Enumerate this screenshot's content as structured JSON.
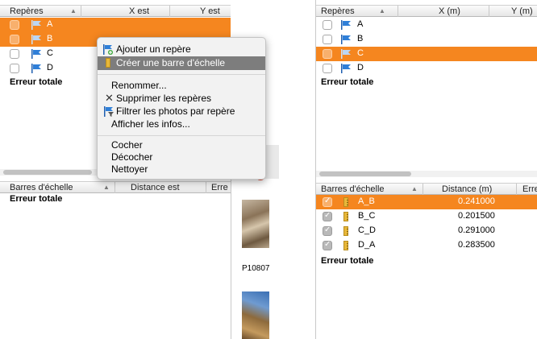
{
  "left_panel": {
    "markers_header": {
      "name": "Repères",
      "x": "X est",
      "y": "Y est"
    },
    "markers": [
      {
        "label": "A",
        "selected": true,
        "checked": false
      },
      {
        "label": "B",
        "selected": true,
        "checked": false
      },
      {
        "label": "C",
        "selected": false,
        "checked": false
      },
      {
        "label": "D",
        "selected": false,
        "checked": false
      }
    ],
    "total_error": "Erreur totale",
    "scalebars_header": {
      "name": "Barres d'échelle",
      "distance": "Distance est",
      "error": "Erre"
    },
    "scalebars_total_error": "Erreur totale"
  },
  "context_menu": {
    "items": [
      {
        "label": "Ajouter un repère",
        "icon": "flag-add-icon"
      },
      {
        "label": "Créer une barre d'échelle",
        "icon": "ruler-icon",
        "highlighted": true
      },
      {
        "label": "Renommer..."
      },
      {
        "label": "Supprimer les repères",
        "icon": "x-icon"
      },
      {
        "label": "Filtrer les photos par repère",
        "icon": "filter-flag-icon"
      },
      {
        "label": "Afficher les infos..."
      },
      {
        "label": "Cocher"
      },
      {
        "label": "Décocher"
      },
      {
        "label": "Nettoyer"
      }
    ]
  },
  "photo_panel": {
    "thumb_label": "P10807"
  },
  "right_panel": {
    "markers_header": {
      "name": "Repères",
      "x": "X (m)",
      "y": "Y (m)"
    },
    "markers": [
      {
        "label": "A",
        "selected": false
      },
      {
        "label": "B",
        "selected": false
      },
      {
        "label": "C",
        "selected": true
      },
      {
        "label": "D",
        "selected": false
      }
    ],
    "total_error": "Erreur totale",
    "scalebars_header": {
      "name": "Barres d'échelle",
      "distance": "Distance (m)",
      "error": "Erre"
    },
    "scalebars": [
      {
        "label": "A_B",
        "distance": "0.241000",
        "selected": true
      },
      {
        "label": "B_C",
        "distance": "0.201500",
        "selected": false
      },
      {
        "label": "C_D",
        "distance": "0.291000",
        "selected": false
      },
      {
        "label": "D_A",
        "distance": "0.283500",
        "selected": false
      }
    ],
    "scalebars_total_error": "Erreur totale"
  },
  "colors": {
    "selection": "#f5861f",
    "menu_highlight": "#7d7d7d",
    "flag_blue": "#2f7fd8"
  }
}
